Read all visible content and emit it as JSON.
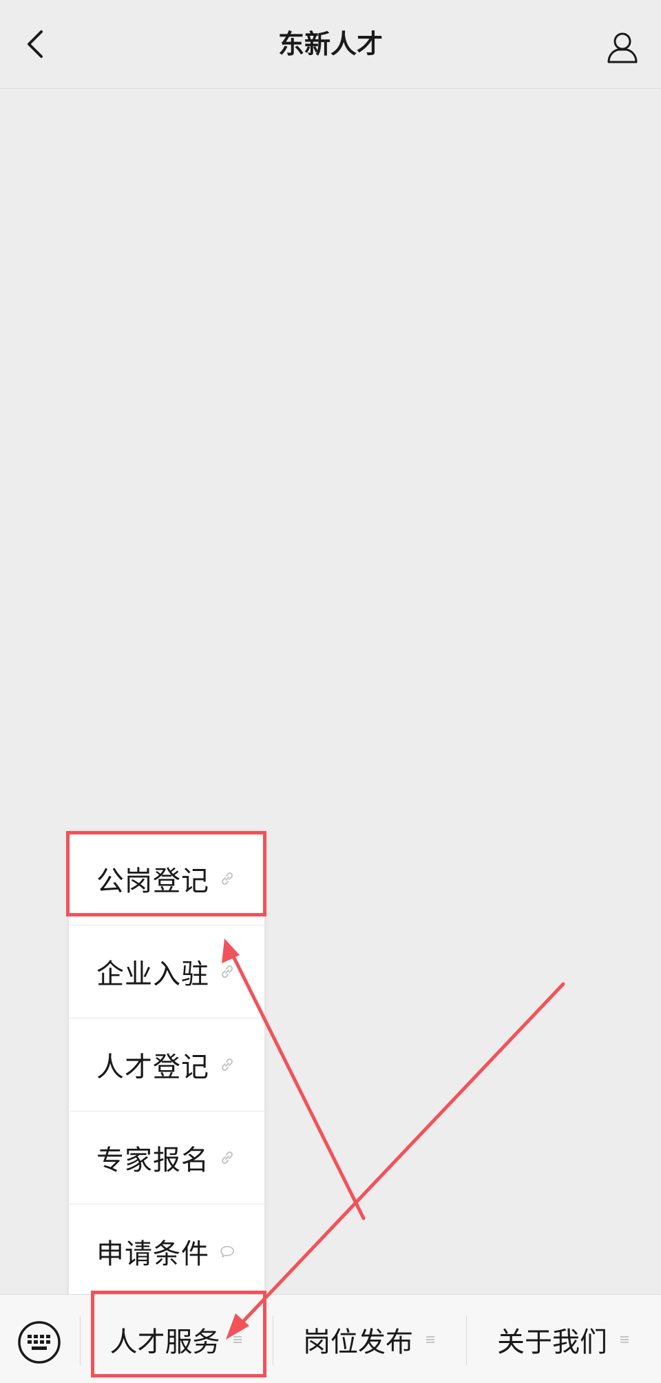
{
  "header": {
    "title": "东新人才"
  },
  "submenu": {
    "items": [
      {
        "label": "公岗登记",
        "icon": "link-icon"
      },
      {
        "label": "企业入驻",
        "icon": "link-icon"
      },
      {
        "label": "人才登记",
        "icon": "link-icon"
      },
      {
        "label": "专家报名",
        "icon": "link-icon"
      },
      {
        "label": "申请条件",
        "icon": "message-icon"
      }
    ]
  },
  "menubar": {
    "items": [
      {
        "label": "人才服务"
      },
      {
        "label": "岗位发布"
      },
      {
        "label": "关于我们"
      }
    ]
  },
  "colors": {
    "background": "#ededed",
    "highlight": "#f2525a",
    "text": "#1a1a1a"
  }
}
